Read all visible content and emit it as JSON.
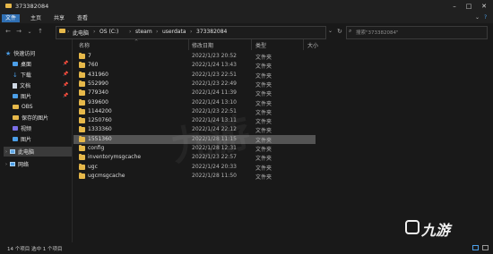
{
  "window": {
    "title": "373382084"
  },
  "ribbon": {
    "tabs": [
      "文件",
      "主页",
      "共享",
      "查看"
    ],
    "active_index": 0
  },
  "address": {
    "breadcrumb": [
      "此电脑",
      "OS (C:)",
      "steam",
      "userdata",
      "373382084"
    ]
  },
  "search": {
    "placeholder": "搜索\"373382084\""
  },
  "sidebar": {
    "items": [
      {
        "label": "快速访问",
        "icon": "star-icon"
      },
      {
        "label": "桌面",
        "icon": "desktop-icon",
        "pinned": true
      },
      {
        "label": "下载",
        "icon": "download-icon",
        "pinned": true
      },
      {
        "label": "文档",
        "icon": "document-icon",
        "pinned": true
      },
      {
        "label": "图片",
        "icon": "picture-icon",
        "pinned": true
      },
      {
        "label": "OBS",
        "icon": "folder-icon"
      },
      {
        "label": "保存的图片",
        "icon": "folder-icon"
      },
      {
        "label": "视频",
        "icon": "video-icon"
      },
      {
        "label": "图片",
        "icon": "picture-icon"
      },
      {
        "label": "此电脑",
        "icon": "pc-icon",
        "selected": true
      },
      {
        "label": "网络",
        "icon": "network-icon"
      }
    ]
  },
  "columns": {
    "name": "名称",
    "date": "修改日期",
    "type": "类型",
    "size": "大小"
  },
  "files": [
    {
      "name": "7",
      "date": "2022/1/23 20:52",
      "type": "文件夹"
    },
    {
      "name": "760",
      "date": "2022/1/24 13:43",
      "type": "文件夹"
    },
    {
      "name": "431960",
      "date": "2022/1/23 22:51",
      "type": "文件夹"
    },
    {
      "name": "552990",
      "date": "2022/1/23 22:49",
      "type": "文件夹"
    },
    {
      "name": "779340",
      "date": "2022/1/24 11:39",
      "type": "文件夹"
    },
    {
      "name": "939600",
      "date": "2022/1/24 13:10",
      "type": "文件夹"
    },
    {
      "name": "1144200",
      "date": "2022/1/23 22:51",
      "type": "文件夹"
    },
    {
      "name": "1250760",
      "date": "2022/1/24 13:11",
      "type": "文件夹"
    },
    {
      "name": "1333360",
      "date": "2022/1/24 22:12",
      "type": "文件夹"
    },
    {
      "name": "1551360",
      "date": "2022/1/28 11:15",
      "type": "文件夹",
      "selected": true
    },
    {
      "name": "config",
      "date": "2022/1/28 12:31",
      "type": "文件夹"
    },
    {
      "name": "inventorymsgcache",
      "date": "2022/1/23 22:57",
      "type": "文件夹"
    },
    {
      "name": "ugc",
      "date": "2022/1/24 20:33",
      "type": "文件夹"
    },
    {
      "name": "ugcmsgcache",
      "date": "2022/1/28 11:50",
      "type": "文件夹"
    }
  ],
  "status": {
    "text": "14 个项目   选中 1 个项目"
  },
  "watermark": {
    "text": "九游"
  }
}
